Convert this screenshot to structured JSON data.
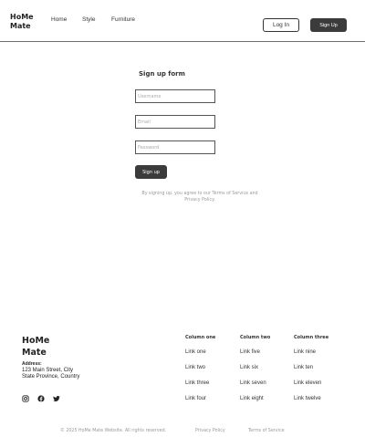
{
  "header": {
    "logo": "HoMe Mate",
    "nav": [
      "Home",
      "Style",
      "Furniture"
    ],
    "login_label": "Log In",
    "signup_label": "Sign Up"
  },
  "form": {
    "title": "Sign up form",
    "username_placeholder": "Username",
    "email_placeholder": "Email",
    "password_placeholder": "Password",
    "submit_label": "Sign up",
    "terms_prefix": "By signing up, you agree to our",
    "terms_link": "Terms of Service",
    "terms_and": "and",
    "privacy_link": "Privacy Policy."
  },
  "footer": {
    "logo": "HoMe Mate",
    "address_label": "Address:",
    "address_line1": "123 Main Street, City",
    "address_line2": "State Province, Country",
    "socials": [
      "instagram-icon",
      "facebook-icon",
      "twitter-icon"
    ],
    "columns": [
      {
        "title": "Column one",
        "links": [
          "Link one",
          "Link two",
          "Link three",
          "Link four"
        ]
      },
      {
        "title": "Column two",
        "links": [
          "Link five",
          "Link six",
          "Link seven",
          "Link eight"
        ]
      },
      {
        "title": "Column three",
        "links": [
          "Link nine",
          "Link ten",
          "Link eleven",
          "Link twelve"
        ]
      }
    ],
    "copyright": "© 2025 HoMe Mate Website. All rights reserved.",
    "privacy": "Privacy Policy",
    "terms": "Terms of Service"
  }
}
